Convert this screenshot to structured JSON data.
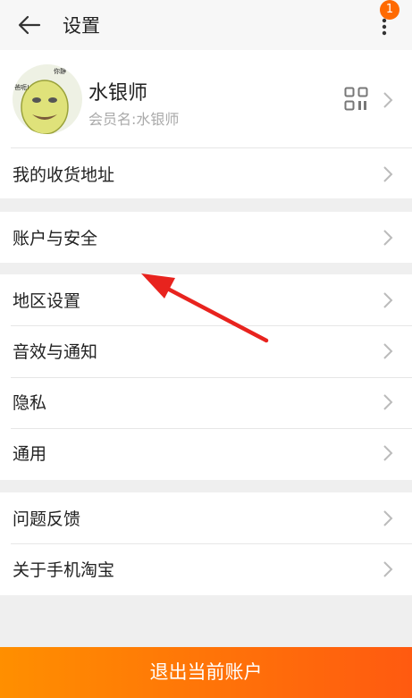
{
  "header": {
    "title": "设置",
    "badge_count": "1"
  },
  "profile": {
    "name": "水银师",
    "member_label": "会员名:水银师"
  },
  "sections": {
    "s1": {
      "address": "我的收货地址"
    },
    "s2": {
      "account": "账户与安全"
    },
    "s3": {
      "region": "地区设置",
      "sound": "音效与通知",
      "privacy": "隐私",
      "general": "通用"
    },
    "s4": {
      "feedback": "问题反馈",
      "about": "关于手机淘宝"
    }
  },
  "logout": {
    "label": "退出当前账户"
  },
  "colors": {
    "accent_start": "#ff8f00",
    "accent_end": "#ff5a10",
    "badge": "#ff6a00",
    "annotation_arrow": "#e8231e"
  },
  "avatar_text": "你静静…爸呃!"
}
